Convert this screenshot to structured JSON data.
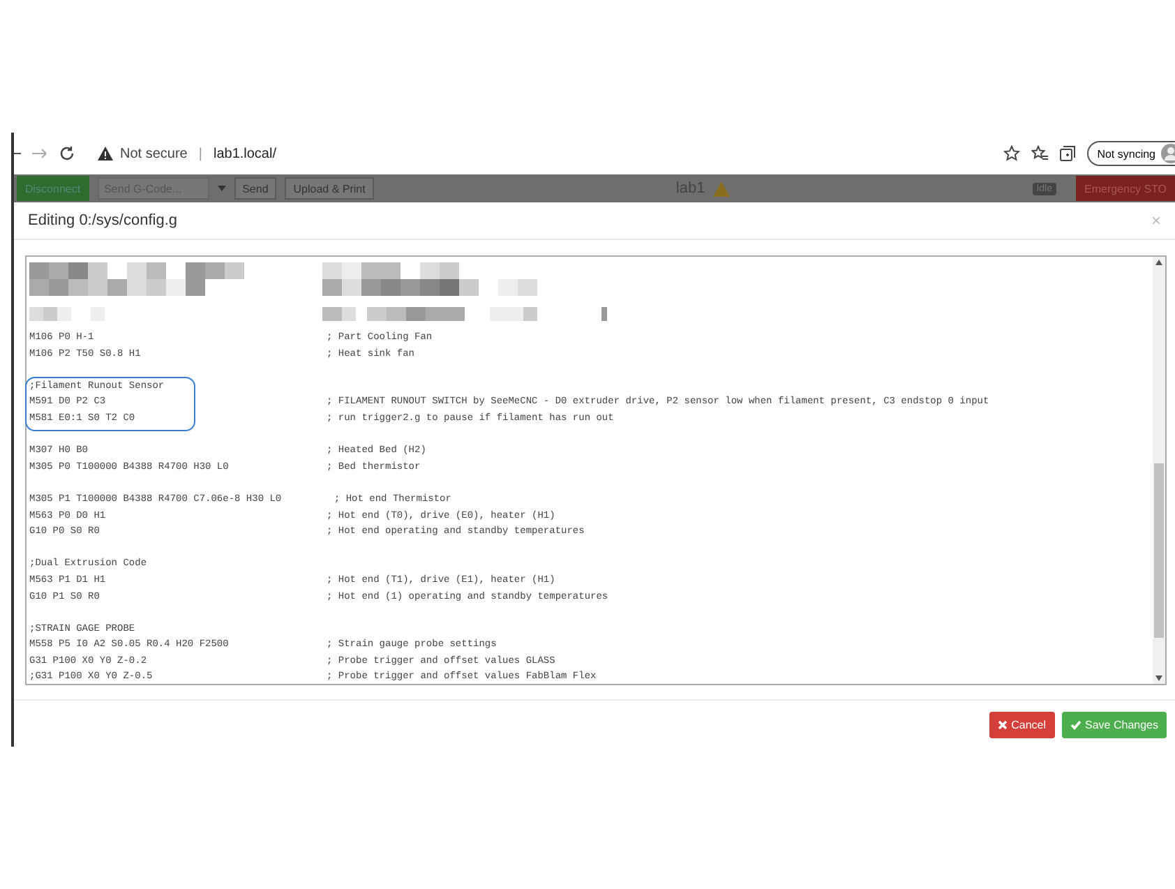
{
  "browser": {
    "address_warning": "Not secure",
    "separator": "|",
    "url": "lab1.local/",
    "sync_label": "Not syncing"
  },
  "app_bar": {
    "disconnect": "Disconnect",
    "gcode_placeholder": "Send G-Code...",
    "send": "Send",
    "upload": "Upload & Print",
    "title": "lab1",
    "status": "Idle",
    "emergency": "Emergency STO"
  },
  "dialog": {
    "title": "Editing 0:/sys/config.g",
    "close": "×",
    "blocks": [
      {
        "kind": "redacted"
      },
      {
        "kind": "code",
        "circled": false,
        "lines": [
          {
            "code": "M106 P0 H-1",
            "comment": "; Part Cooling Fan"
          },
          {
            "code": "M106 P2 T50 S0.8 H1",
            "comment": "; Heat sink fan"
          }
        ]
      },
      {
        "kind": "code",
        "circled": true,
        "lines": [
          {
            "code": ";Filament Runout Sensor"
          },
          {
            "code": "M591 D0 P2 C3",
            "comment": "; FILAMENT RUNOUT SWITCH by SeeMeCNC - D0 extruder drive, P2 sensor low when filament present, C3 endstop 0 input"
          },
          {
            "code": "M581 E0:1 S0 T2 C0",
            "comment": "; run trigger2.g to pause if filament has run out"
          }
        ]
      },
      {
        "kind": "code",
        "circled": false,
        "lines": [
          {
            "code": "M307 H0 B0",
            "comment": "; Heated Bed (H2)"
          },
          {
            "code": "M305 P0 T100000 B4388 R4700 H30 L0",
            "comment": "; Bed thermistor"
          }
        ]
      },
      {
        "kind": "code",
        "circled": false,
        "lines": [
          {
            "code": "M305 P1 T100000 B4388 R4700 C7.06e-8 H30 L0         ; Hot end Thermistor"
          },
          {
            "code": "M563 P0 D0 H1",
            "comment": "; Hot end (T0), drive (E0), heater (H1)"
          },
          {
            "code": "G10 P0 S0 R0",
            "comment": "; Hot end operating and standby temperatures"
          }
        ]
      },
      {
        "kind": "code",
        "circled": false,
        "lines": [
          {
            "code": ";Dual Extrusion Code"
          },
          {
            "code": "M563 P1 D1 H1",
            "comment": "; Hot end (T1), drive (E1), heater (H1)"
          },
          {
            "code": "G10 P1 S0 R0",
            "comment": "; Hot end (1) operating and standby temperatures"
          }
        ]
      },
      {
        "kind": "code",
        "circled": false,
        "lines": [
          {
            "code": ";STRAIN GAGE PROBE"
          },
          {
            "code": "M558 P5 I0 A2 S0.05 R0.4 H20 F2500",
            "comment": "; Strain gauge probe settings"
          },
          {
            "code": "G31 P100 X0 Y0 Z-0.2",
            "comment": "; Probe trigger and offset values GLASS"
          },
          {
            "code": ";G31 P100 X0 Y0 Z-0.5",
            "comment": "; Probe trigger and offset values FabBlam Flex"
          }
        ]
      }
    ],
    "buttons": [
      {
        "kind": "cancel",
        "label": "Cancel"
      },
      {
        "kind": "save",
        "label": "Save Changes"
      }
    ]
  }
}
